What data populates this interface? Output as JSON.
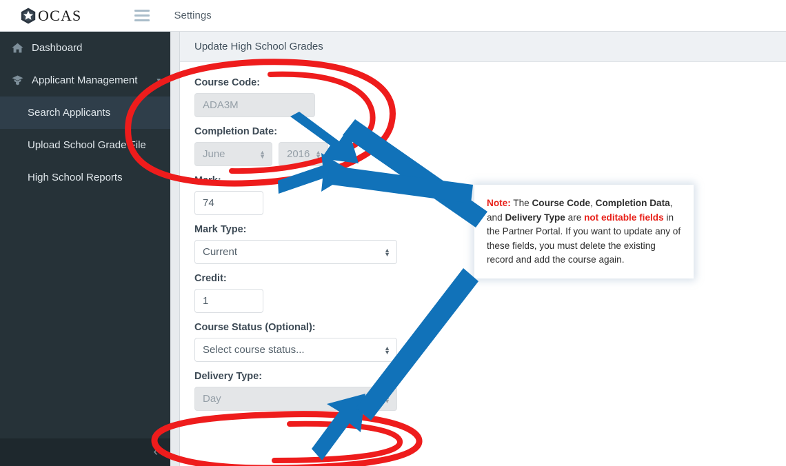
{
  "topbar": {
    "logo_text": "OCAS",
    "logo_icon": "ocas-cube-star-logo",
    "menu_icon": "hamburger-menu-icon",
    "settings_label": "Settings"
  },
  "sidebar": {
    "items": [
      {
        "label": "Dashboard",
        "icon": "home-icon",
        "level": "top",
        "active": false,
        "caret": ""
      },
      {
        "label": "Applicant Management",
        "icon": "graduate-user-icon",
        "level": "top",
        "active": false,
        "caret": "⌄"
      },
      {
        "label": "Search Applicants",
        "icon": "",
        "level": "sub",
        "active": true,
        "caret": ""
      },
      {
        "label": "Upload School Grade File",
        "icon": "",
        "level": "sub",
        "active": false,
        "caret": ""
      },
      {
        "label": "High School Reports",
        "icon": "",
        "level": "sub",
        "active": false,
        "caret": ""
      }
    ],
    "collapse_icon": "chevron-left-icon"
  },
  "panel": {
    "title": "Update High School Grades"
  },
  "form": {
    "course_code": {
      "label": "Course Code:",
      "value": "ADA3M",
      "disabled": true
    },
    "completion_date": {
      "label": "Completion Date:",
      "month_value": "June",
      "year_value": "2016",
      "disabled": true
    },
    "mark": {
      "label": "Mark:",
      "value": "74",
      "disabled": false
    },
    "mark_type": {
      "label": "Mark Type:",
      "value": "Current",
      "disabled": false
    },
    "credit": {
      "label": "Credit:",
      "value": "1",
      "disabled": false
    },
    "course_status": {
      "label": "Course Status (Optional):",
      "value": "Select course status...",
      "disabled": false
    },
    "delivery_type": {
      "label": "Delivery Type:",
      "value": "Day",
      "disabled": true
    }
  },
  "note": {
    "prefix": "Note:",
    "t1": " The ",
    "b1": "Course Code",
    "t2": ", ",
    "b2": "Completion Data",
    "t3": ", and ",
    "b3": "Delivery Type",
    "t4": " are ",
    "r1": "not editable fields",
    "t5": " in the Partner Portal. If you want to update any of these fields, you must delete the existing record and add the course again."
  },
  "annotations": {
    "ellipse_color": "#ee1c1c",
    "arrow_color": "#1172b9",
    "note_accent": "#e8211a"
  }
}
